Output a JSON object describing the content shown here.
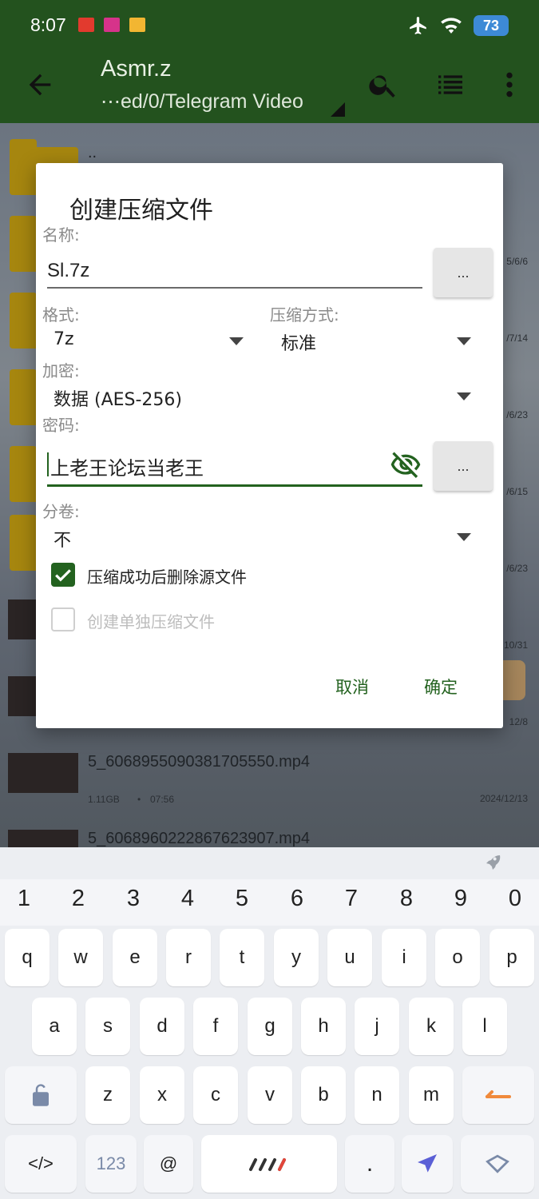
{
  "status_bar": {
    "time": "8:07",
    "battery": "73",
    "notif_colors": [
      "#e23a2e",
      "#d6338a",
      "#f2b632"
    ]
  },
  "app_bar": {
    "title": "Asmr.z",
    "path": "⋯ed/0/Telegram Video",
    "icons": [
      "back-arrow-icon",
      "search-icon",
      "list-view-icon",
      "more-vert-icon"
    ]
  },
  "file_list": {
    "parent_label": "..",
    "dates": [
      "5/6/6",
      "/7/14",
      "/6/23",
      "/6/15",
      "/6/23",
      "10/31",
      "12/8"
    ],
    "files": [
      {
        "name": "5_6068955090381705550.mp4",
        "size": "1.11GB",
        "duration": "07:56",
        "date": "2024/12/13"
      },
      {
        "name": "5_6068960222867623907.mp4"
      }
    ]
  },
  "dialog": {
    "title": "创建压缩文件",
    "name_label": "名称:",
    "name_value": "Sl.7z",
    "browse_label": "...",
    "format_label": "格式:",
    "format_value": "7z",
    "method_label": "压缩方式:",
    "method_value": "标准",
    "encrypt_label": "加密:",
    "encrypt_value": "数据 (AES-256)",
    "password_label": "密码:",
    "password_value": "上老王论坛当老王",
    "split_label": "分卷:",
    "split_value": "不",
    "delete_source_label": "压缩成功后删除源文件",
    "delete_source_checked": true,
    "separate_label": "创建单独压缩文件",
    "separate_checked": false,
    "cancel_label": "取消",
    "ok_label": "确定"
  },
  "keyboard": {
    "numbers": [
      "1",
      "2",
      "3",
      "4",
      "5",
      "6",
      "7",
      "8",
      "9",
      "0"
    ],
    "row1": [
      "q",
      "w",
      "e",
      "r",
      "t",
      "y",
      "u",
      "i",
      "o",
      "p"
    ],
    "row2": [
      "a",
      "s",
      "d",
      "f",
      "g",
      "h",
      "j",
      "k",
      "l"
    ],
    "row3": [
      "z",
      "x",
      "c",
      "v",
      "b",
      "n",
      "m"
    ],
    "code_key": "</>",
    "num_key": "123",
    "at_key": "@",
    "period_key": ".",
    "accent": "#f08a3c"
  }
}
